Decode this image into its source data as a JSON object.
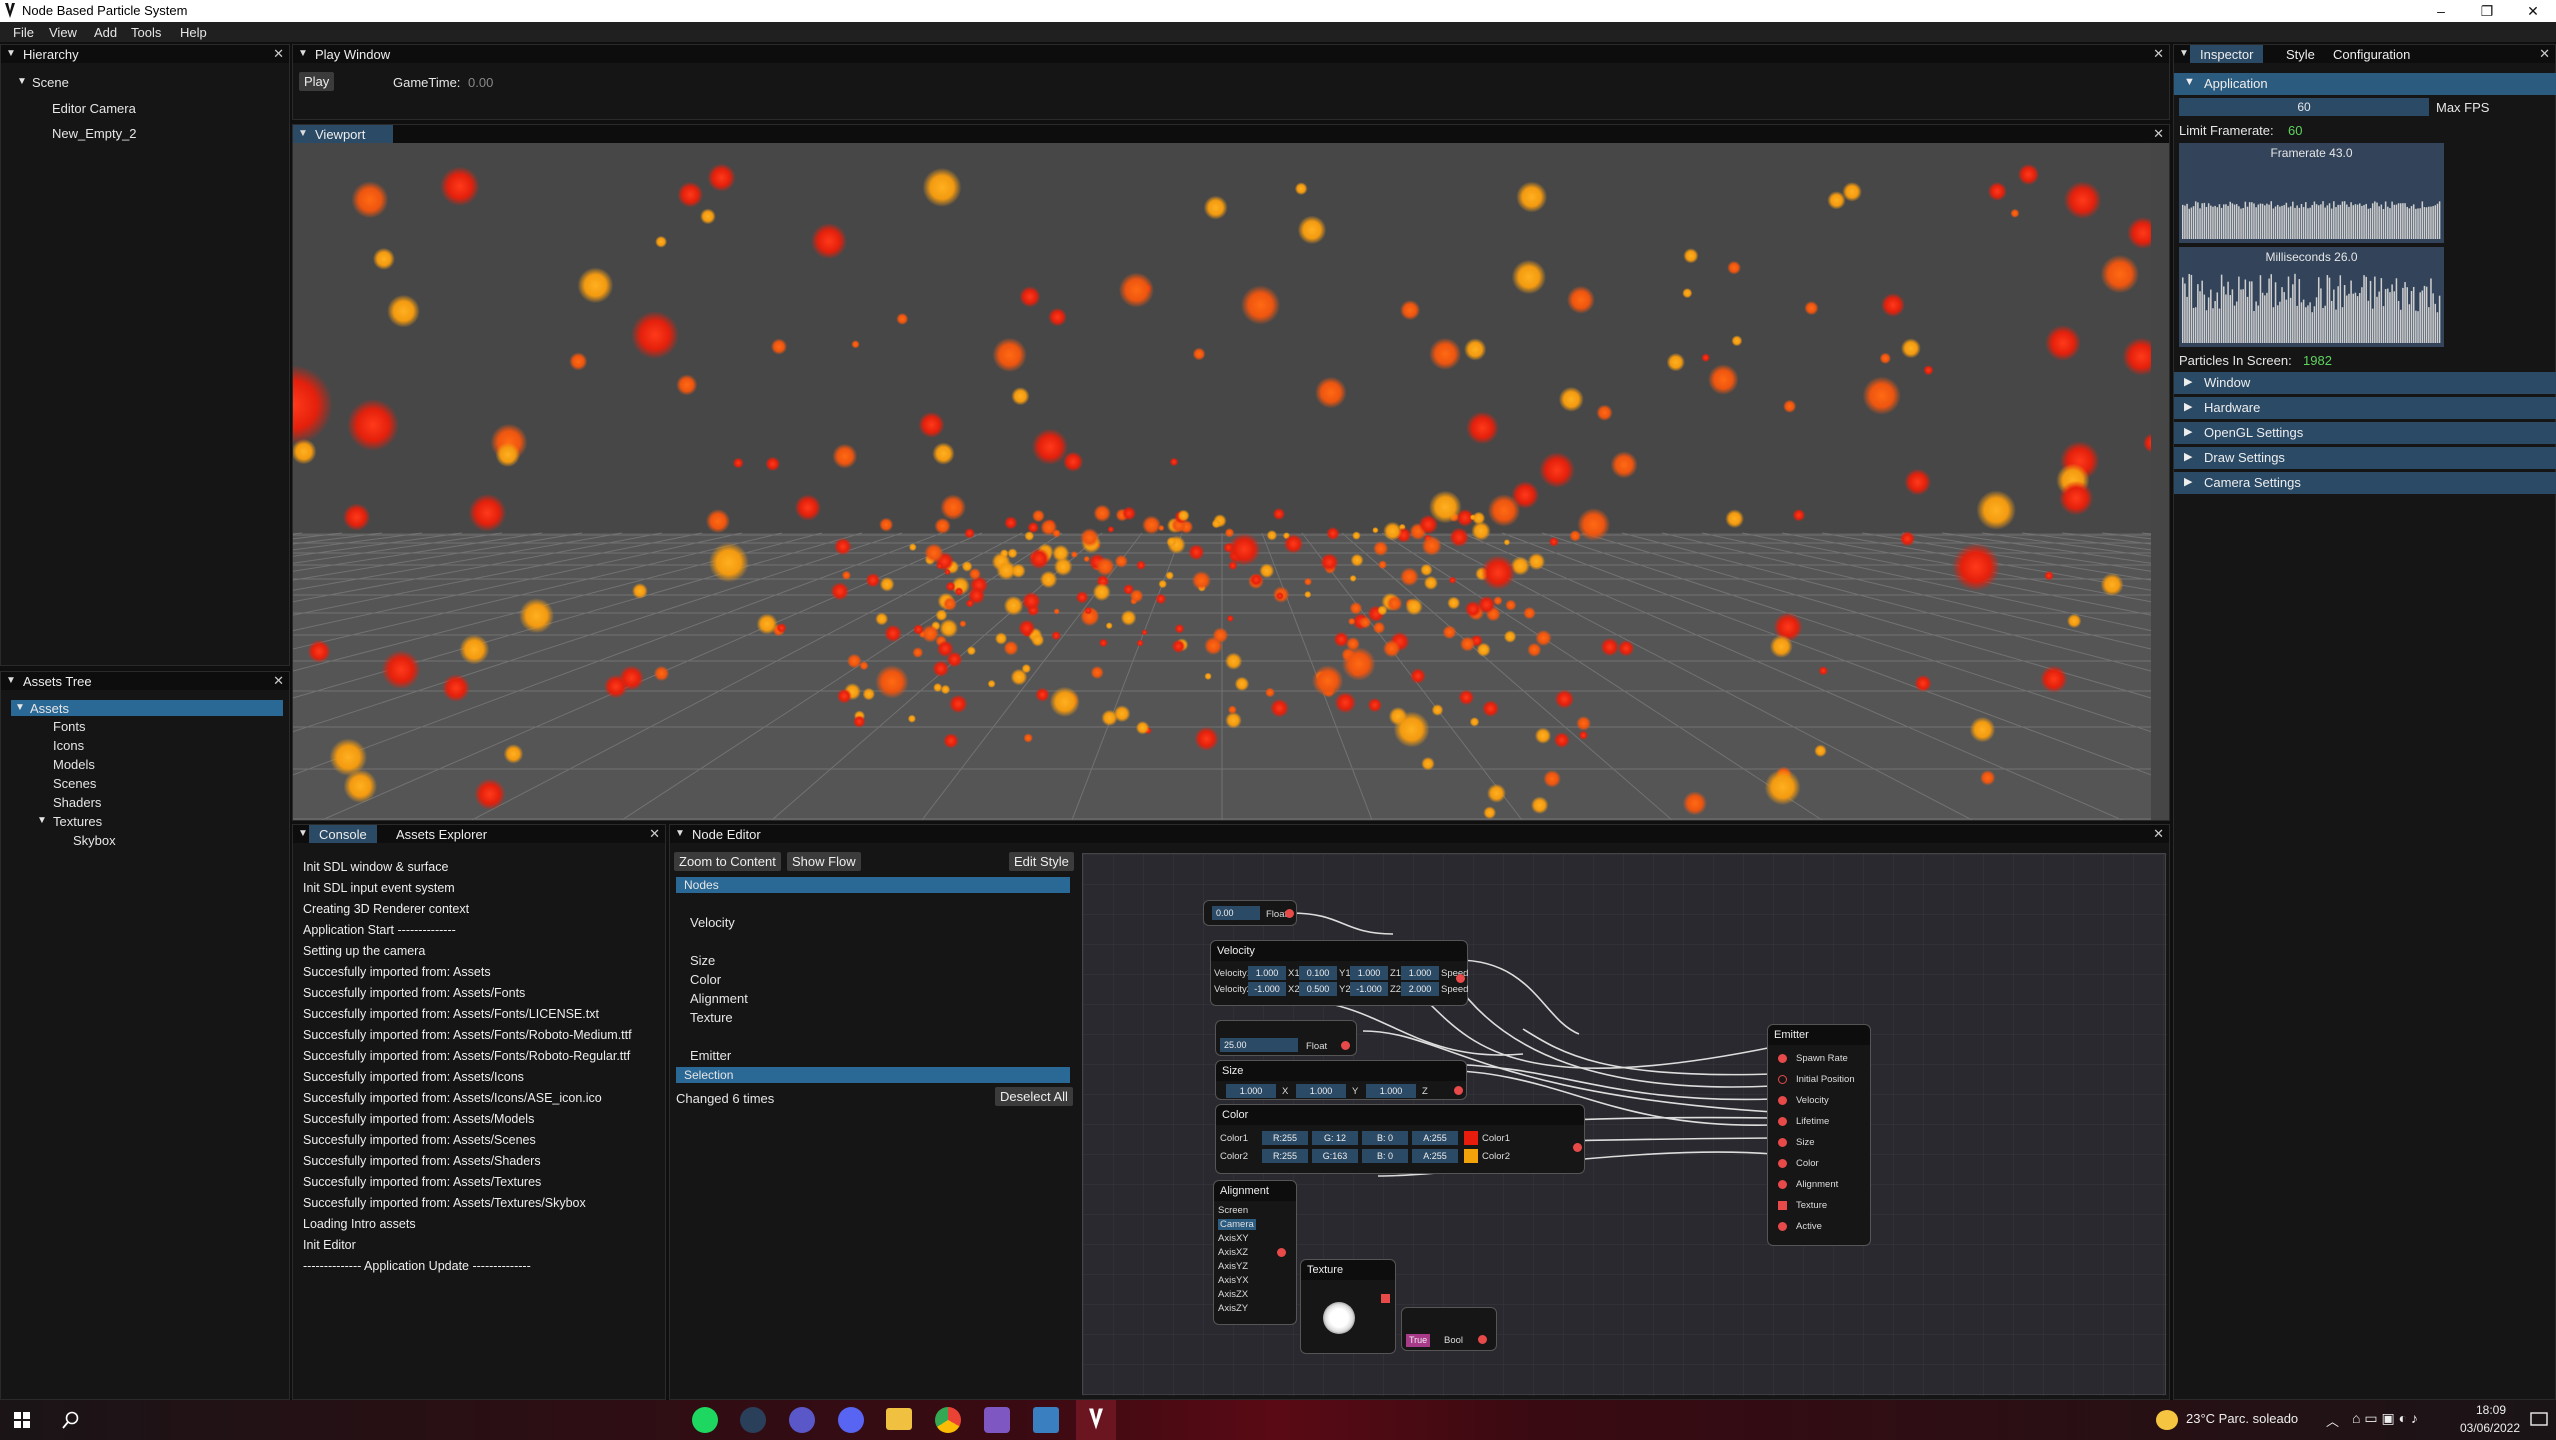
{
  "window": {
    "title": "Node Based Particle System",
    "btn_min": "–",
    "btn_max": "❐",
    "btn_close": "✕"
  },
  "menu": {
    "file": "File",
    "view": "View",
    "add": "Add",
    "tools": "Tools",
    "help": "Help"
  },
  "hierarchy": {
    "title": "Hierarchy",
    "close": "✕",
    "scene": "Scene",
    "items": [
      "Editor Camera",
      "New_Empty_2"
    ]
  },
  "play_window": {
    "title": "Play Window",
    "play": "Play",
    "gametime_label": "GameTime:",
    "gametime_value": "0.00"
  },
  "viewport": {
    "title": "Viewport"
  },
  "assets_tree": {
    "title": "Assets Tree",
    "root": "Assets",
    "items": [
      "Fonts",
      "Icons",
      "Models",
      "Scenes",
      "Shaders"
    ],
    "textures": "Textures",
    "textures_children": [
      "Skybox"
    ]
  },
  "console": {
    "tab_console": "Console",
    "tab_assets": "Assets Explorer",
    "lines": [
      "Init SDL window & surface",
      "Init SDL input event system",
      "Creating 3D Renderer context",
      "Application Start --------------",
      "Setting up the camera",
      "Succesfully imported from: Assets",
      "Succesfully imported from: Assets/Fonts",
      "Succesfully imported from: Assets/Fonts/LICENSE.txt",
      "Succesfully imported from: Assets/Fonts/Roboto-Medium.ttf",
      "Succesfully imported from: Assets/Fonts/Roboto-Regular.ttf",
      "Succesfully imported from: Assets/Icons",
      "Succesfully imported from: Assets/Icons/ASE_icon.ico",
      "Succesfully imported from: Assets/Models",
      "Succesfully imported from: Assets/Scenes",
      "Succesfully imported from: Assets/Shaders",
      "Succesfully imported from: Assets/Textures",
      "Succesfully imported from: Assets/Textures/Skybox",
      "Loading Intro assets",
      "Init Editor",
      "-------------- Application Update --------------"
    ]
  },
  "node_editor": {
    "title": "Node Editor",
    "zoom": "Zoom to Content",
    "flow": "Show Flow",
    "edit_style": "Edit Style",
    "nodes_header": "Nodes",
    "node_list": [
      "Velocity",
      "Size",
      "Color",
      "Alignment",
      "Texture",
      "Emitter"
    ],
    "selection_header": "Selection",
    "changed": "Changed 6 times",
    "deselect": "Deselect All"
  },
  "graph": {
    "float1": {
      "value": "0.00",
      "label": "Float"
    },
    "velocity": {
      "title": "Velocity",
      "row1": "Velocity1",
      "row2": "Velocity2",
      "v1": [
        "1.000",
        "0.100",
        "1.000",
        "1.000"
      ],
      "v2": [
        "-1.000",
        "0.500",
        "-1.000",
        "2.000"
      ],
      "axes": [
        "X1",
        "Y1",
        "Z1"
      ],
      "axes2": [
        "X2",
        "Y2",
        "Z2"
      ],
      "speed": "Speed"
    },
    "float2": {
      "value": "25.00",
      "label": "Float"
    },
    "size": {
      "title": "Size",
      "vals": [
        "1.000",
        "1.000",
        "1.000"
      ],
      "axes": [
        "X",
        "Y",
        "Z"
      ]
    },
    "color": {
      "title": "Color",
      "row1": "Color1",
      "row2": "Color2",
      "c1": [
        "R:255",
        "G: 12",
        "B: 0",
        "A:255"
      ],
      "c2": [
        "R:255",
        "G:163",
        "B: 0",
        "A:255"
      ],
      "lab1": "Color1",
      "lab2": "Color2",
      "swatch1": "#e81c0c",
      "swatch2": "#f3a30a"
    },
    "alignment": {
      "title": "Alignment",
      "options": [
        "Screen",
        "Camera",
        "AxisXY",
        "AxisXZ",
        "AxisYZ",
        "AxisYX",
        "AxisZX",
        "AxisZY"
      ]
    },
    "texture": {
      "title": "Texture"
    },
    "bool": {
      "value": "True",
      "label": "Bool"
    },
    "emitter": {
      "title": "Emitter",
      "inputs": [
        "Spawn Rate",
        "Initial Position",
        "Velocity",
        "Lifetime",
        "Size",
        "Color",
        "Alignment",
        "Texture",
        "Active"
      ]
    }
  },
  "inspector": {
    "tab": "Inspector",
    "tab_style": "Style",
    "tab_config": "Configuration",
    "section": "Application",
    "max_fps_value": "60",
    "max_fps_label": "Max FPS",
    "limit_label": "Limit Framerate:",
    "limit_value": "60",
    "framerate_title": "Framerate 43.0",
    "ms_title": "Milliseconds 26.0",
    "particles_label": "Particles In Screen:",
    "particles_value": "1982",
    "sections": [
      "Window",
      "Hardware",
      "OpenGL Settings",
      "Draw Settings",
      "Camera Settings"
    ]
  },
  "taskbar": {
    "weather": "23°C  Parc. soleado",
    "time": "18:09",
    "date": "03/06/2022"
  },
  "colors": {
    "accent": "#2a4a66",
    "header_active": "#2c5b80",
    "green": "#5fd35f",
    "particle_red": "#e4200c",
    "particle_orange": "#f39a10"
  }
}
